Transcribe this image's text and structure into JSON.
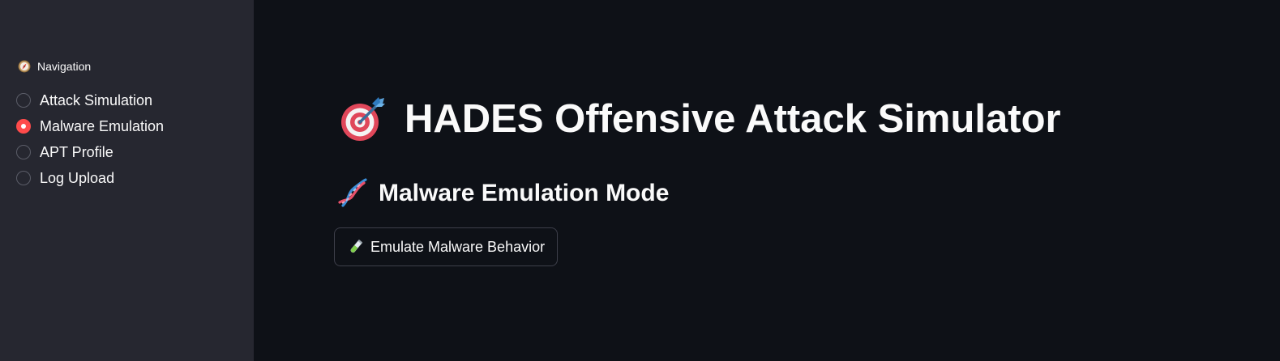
{
  "sidebar": {
    "nav_label": "Navigation",
    "nav_icon": "compass-icon",
    "options": [
      {
        "label": "Attack Simulation",
        "checked": false
      },
      {
        "label": "Malware Emulation",
        "checked": true
      },
      {
        "label": "APT Profile",
        "checked": false
      },
      {
        "label": "Log Upload",
        "checked": false
      }
    ],
    "selected": "Malware Emulation"
  },
  "main": {
    "title": "HADES Offensive Attack Simulator",
    "title_icon": "dart-target-icon",
    "subtitle": "Malware Emulation Mode",
    "subtitle_icon": "dna-icon",
    "button_label": "Emulate Malware Behavior",
    "button_icon": "test-tube-icon"
  },
  "colors": {
    "accent": "#ff4b4b",
    "background": "#0e1117",
    "sidebar": "#262730",
    "text": "#fafafa"
  }
}
